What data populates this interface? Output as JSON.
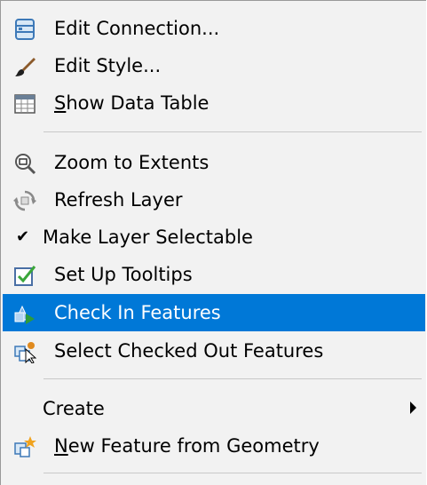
{
  "menu": {
    "items": [
      {
        "label": "Edit Connection...",
        "icon": "database-connection-icon"
      },
      {
        "label": "Edit Style...",
        "icon": "paintbrush-icon"
      },
      {
        "label_prefix": "S",
        "label_rest": "how Data Table",
        "icon": "data-table-icon"
      },
      {
        "label": "Zoom to Extents",
        "icon": "zoom-extents-icon"
      },
      {
        "label": "Refresh Layer",
        "icon": "refresh-icon"
      },
      {
        "label": "Make Layer Selectable",
        "checked": true,
        "check_glyph": "✔"
      },
      {
        "label": "Set Up Tooltips",
        "icon": "tooltip-checkbox-icon"
      },
      {
        "label": "Check In Features",
        "icon": "check-in-features-icon",
        "highlighted": true
      },
      {
        "label": "Select Checked Out Features",
        "icon": "select-checked-out-icon"
      },
      {
        "label": "Create",
        "has_submenu": true
      },
      {
        "label_prefix": "N",
        "label_rest": "ew Feature from Geometry",
        "icon": "new-feature-icon"
      }
    ]
  },
  "colors": {
    "highlight": "#0078d7",
    "menu_background": "#f2f2f2",
    "separator": "#c9c9c9"
  }
}
